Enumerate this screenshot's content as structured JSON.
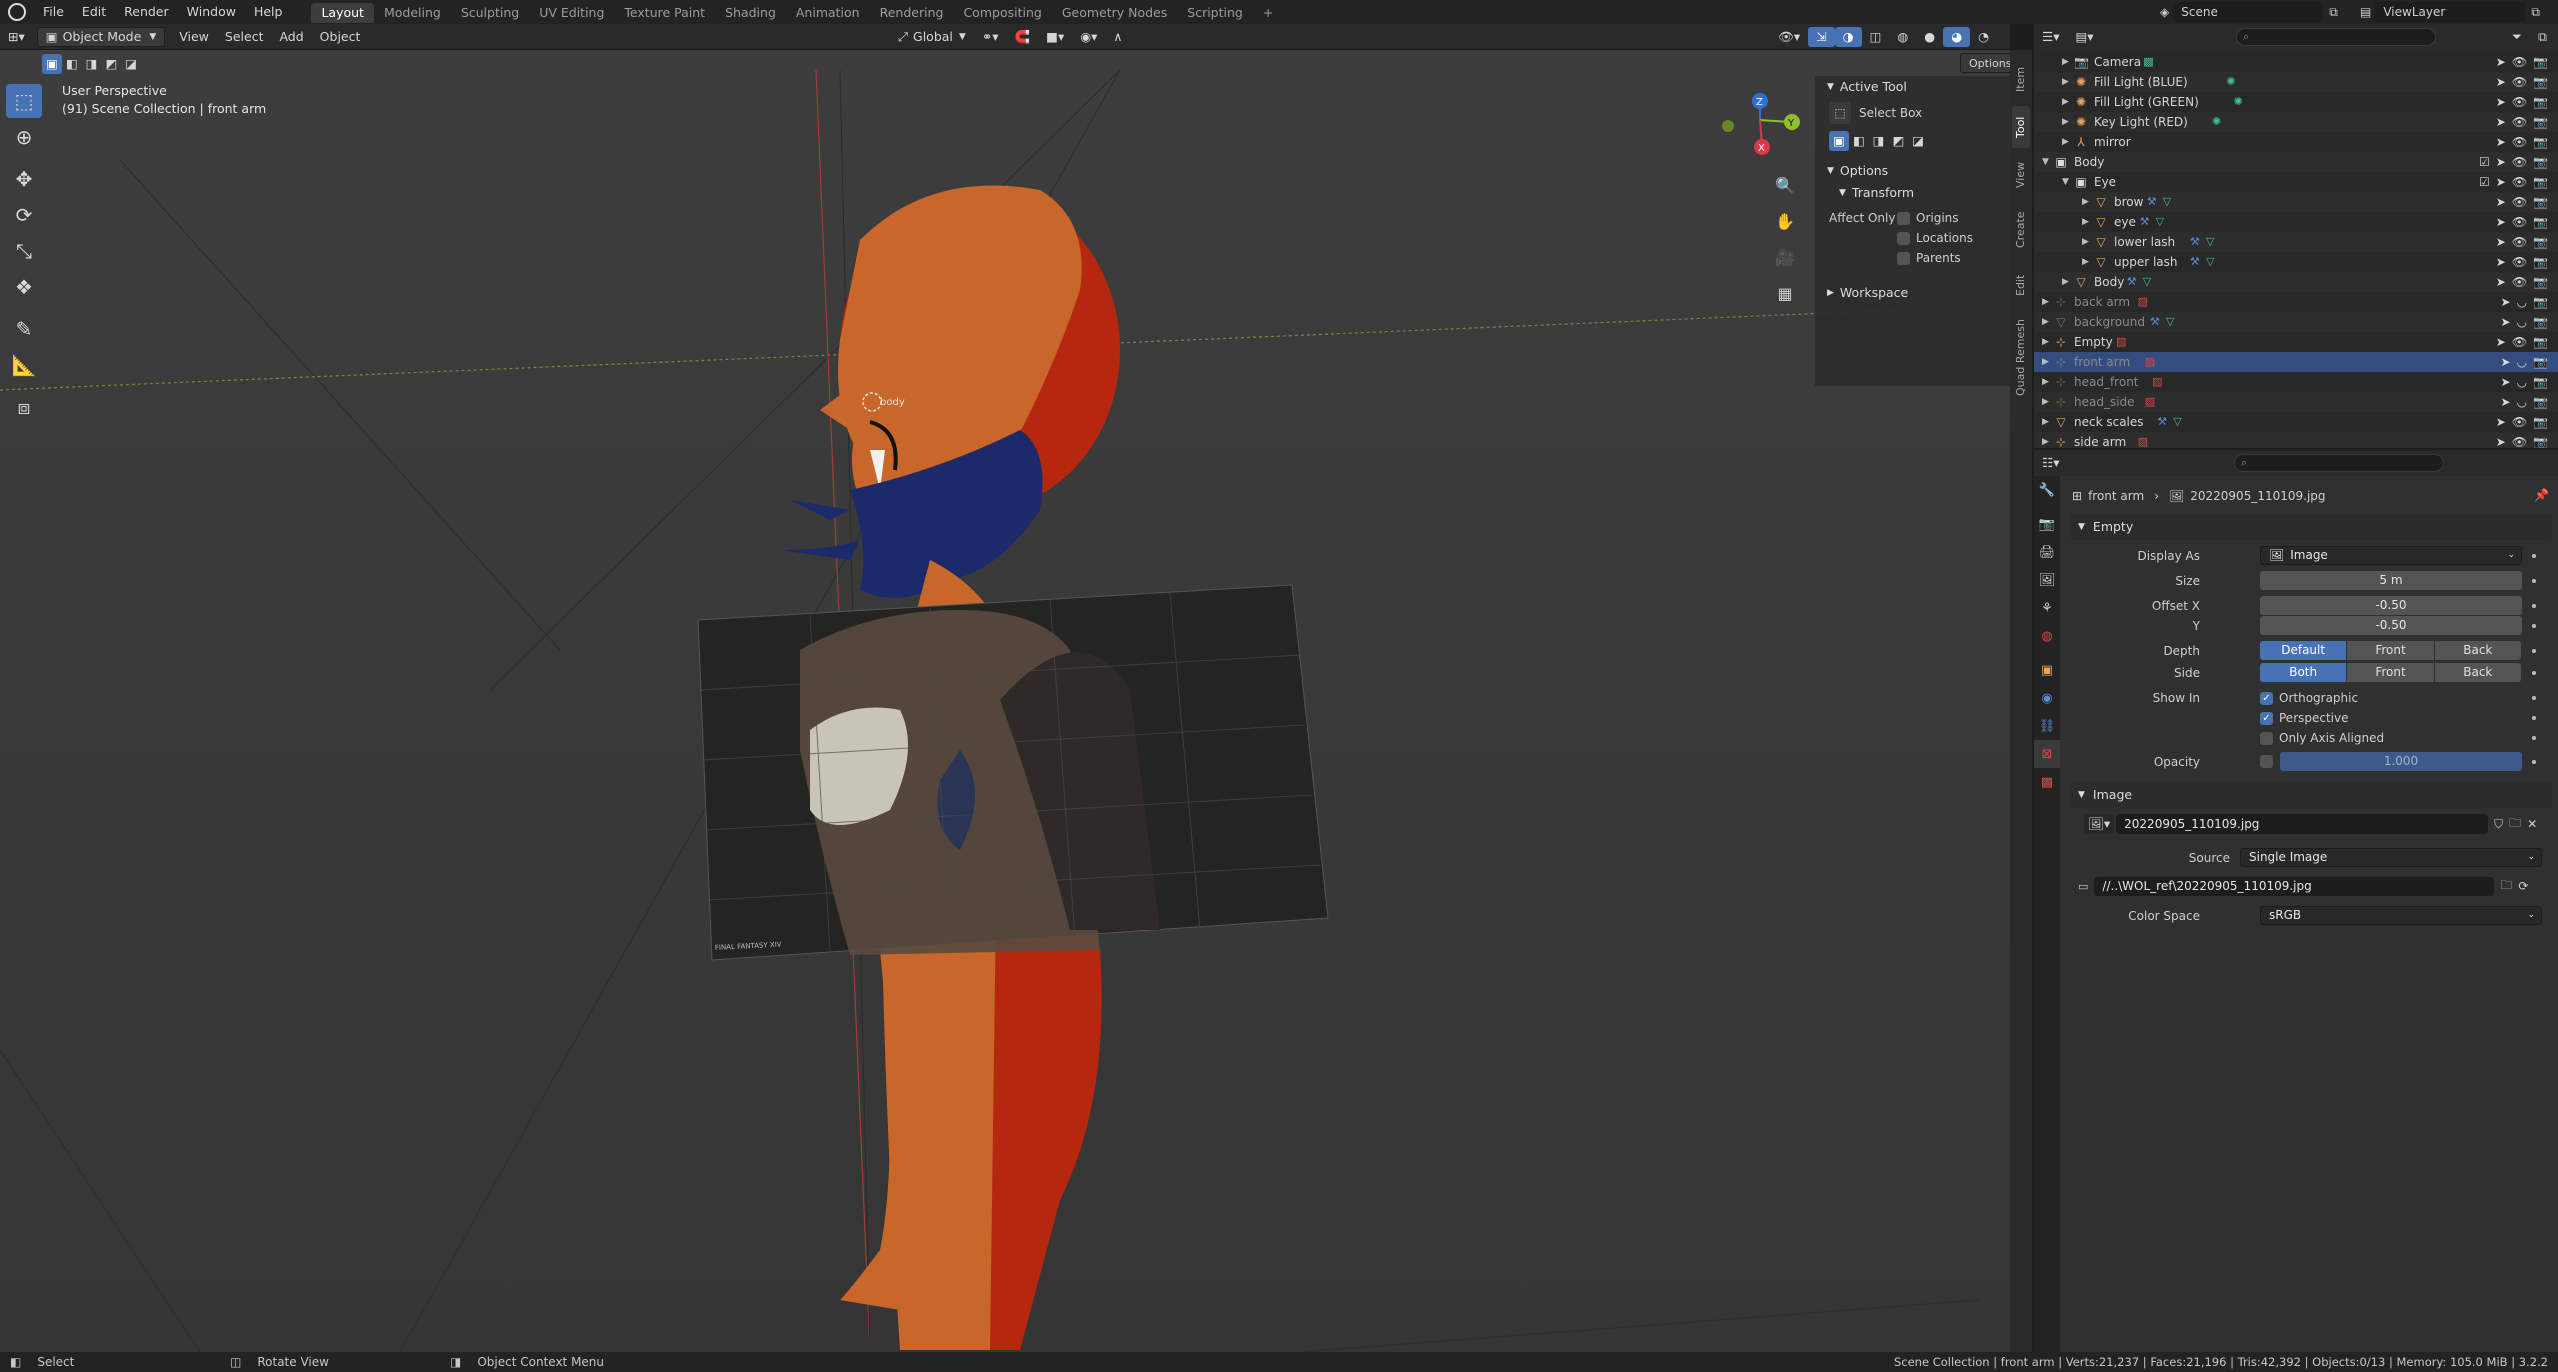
{
  "app": {
    "menus": [
      "File",
      "Edit",
      "Render",
      "Window",
      "Help"
    ],
    "workspaces": [
      "Layout",
      "Modeling",
      "Sculpting",
      "UV Editing",
      "Texture Paint",
      "Shading",
      "Animation",
      "Rendering",
      "Compositing",
      "Geometry Nodes",
      "Scripting"
    ],
    "active_workspace": "Layout",
    "add_tab": "+",
    "scene_label": "Scene",
    "viewlayer_label": "ViewLayer"
  },
  "viewport_header": {
    "mode": "Object Mode",
    "menus": [
      "View",
      "Select",
      "Add",
      "Object"
    ],
    "transform_orientation": "Global",
    "options_label": "Options"
  },
  "viewport": {
    "perspective": "User Perspective",
    "collection_info": "(91) Scene Collection | front arm",
    "object_label": "body",
    "image_caption": "FINAL FANTASY XIV",
    "gizmo_axes": {
      "x": "X",
      "y": "Y",
      "z": "Z"
    }
  },
  "toolbar": {
    "tools": [
      "select-box",
      "cursor",
      "move",
      "rotate",
      "scale",
      "transform",
      "annotate",
      "measure",
      "add-cube"
    ],
    "active": "select-box"
  },
  "n_panel": {
    "active_tool_header": "Active Tool",
    "tool_name": "Select Box",
    "options_header": "Options",
    "transform_header": "Transform",
    "affect_only_label": "Affect Only",
    "affect_only": [
      {
        "label": "Origins",
        "checked": false
      },
      {
        "label": "Locations",
        "checked": false
      },
      {
        "label": "Parents",
        "checked": false
      }
    ],
    "workspace_header": "Workspace"
  },
  "n_tabs": [
    "Item",
    "Tool",
    "View",
    "Create",
    "Edit",
    "Quad Remesh"
  ],
  "n_tab_active": "Tool",
  "outliner": {
    "rows": [
      {
        "label": "Camera",
        "depth": 1,
        "icon": "camera-icon",
        "color": "#e8a35c",
        "dim": false,
        "selected": false
      },
      {
        "label": "Fill Light (BLUE)",
        "depth": 1,
        "icon": "light-icon",
        "color": "#e8a35c",
        "dim": false,
        "selected": false
      },
      {
        "label": "Fill Light (GREEN)",
        "depth": 1,
        "icon": "light-icon",
        "color": "#e8a35c",
        "dim": false,
        "selected": false
      },
      {
        "label": "Key Light (RED)",
        "depth": 1,
        "icon": "light-icon",
        "color": "#e8a35c",
        "dim": false,
        "selected": false
      },
      {
        "label": "mirror",
        "depth": 1,
        "icon": "armature-icon",
        "color": "#e8a35c",
        "dim": false,
        "selected": false
      },
      {
        "label": "Body",
        "depth": 0,
        "icon": "collection-icon",
        "color": "#e0e0e0",
        "dim": false,
        "selected": false
      },
      {
        "label": "Eye",
        "depth": 1,
        "icon": "collection-icon",
        "color": "#e0e0e0",
        "dim": false,
        "selected": false
      },
      {
        "label": "brow",
        "depth": 2,
        "icon": "mesh-icon",
        "color": "#e8a35c",
        "dim": false,
        "selected": false
      },
      {
        "label": "eye",
        "depth": 2,
        "icon": "mesh-icon",
        "color": "#e8a35c",
        "dim": false,
        "selected": false
      },
      {
        "label": "lower lash",
        "depth": 2,
        "icon": "mesh-icon",
        "color": "#e8a35c",
        "dim": false,
        "selected": false
      },
      {
        "label": "upper lash",
        "depth": 2,
        "icon": "mesh-icon",
        "color": "#e8a35c",
        "dim": false,
        "selected": false
      },
      {
        "label": "Body",
        "depth": 1,
        "icon": "mesh-icon",
        "color": "#e8a35c",
        "dim": false,
        "selected": false
      },
      {
        "label": "back arm",
        "depth": 0,
        "icon": "empty-icon",
        "color": "#e8a35c",
        "dim": true,
        "selected": false
      },
      {
        "label": "background",
        "depth": 0,
        "icon": "mesh-icon",
        "color": "#e8a35c",
        "dim": true,
        "selected": false
      },
      {
        "label": "Empty",
        "depth": 0,
        "icon": "empty-icon",
        "color": "#e8a35c",
        "dim": false,
        "selected": false
      },
      {
        "label": "front arm",
        "depth": 0,
        "icon": "empty-icon",
        "color": "#e8a35c",
        "dim": true,
        "selected": true
      },
      {
        "label": "head_front",
        "depth": 0,
        "icon": "empty-icon",
        "color": "#e8a35c",
        "dim": true,
        "selected": false
      },
      {
        "label": "head_side",
        "depth": 0,
        "icon": "empty-icon",
        "color": "#e8a35c",
        "dim": true,
        "selected": false
      },
      {
        "label": "neck scales",
        "depth": 0,
        "icon": "mesh-icon",
        "color": "#e8a35c",
        "dim": false,
        "selected": false
      },
      {
        "label": "side arm",
        "depth": 0,
        "icon": "empty-icon",
        "color": "#e8a35c",
        "dim": false,
        "selected": false
      }
    ]
  },
  "properties": {
    "breadcrumb_object": "front arm",
    "breadcrumb_data": "20220905_110109.jpg",
    "empty_section": "Empty",
    "display_as_label": "Display As",
    "display_as_value": "Image",
    "size_label": "Size",
    "size_value": "5 m",
    "offset_x_label": "Offset X",
    "offset_x_value": "-0.50",
    "offset_y_label": "Y",
    "offset_y_value": "-0.50",
    "depth_label": "Depth",
    "depth_options": [
      "Default",
      "Front",
      "Back"
    ],
    "depth_selected": "Default",
    "side_label": "Side",
    "side_options": [
      "Both",
      "Front",
      "Back"
    ],
    "side_selected": "Both",
    "show_in_label": "Show In",
    "show_in": [
      {
        "label": "Orthographic",
        "checked": true
      },
      {
        "label": "Perspective",
        "checked": true
      },
      {
        "label": "Only Axis Aligned",
        "checked": false
      }
    ],
    "opacity_label": "Opacity",
    "opacity_value": "1.000",
    "image_section": "Image",
    "image_name": "20220905_110109.jpg",
    "source_label": "Source",
    "source_value": "Single Image",
    "filepath": "//..\\WOL_ref\\20220905_110109.jpg",
    "color_space_label": "Color Space",
    "color_space_value": "sRGB"
  },
  "statusbar": {
    "left": [
      {
        "icon": "mouse-left-icon",
        "label": "Select"
      },
      {
        "icon": "mouse-middle-icon",
        "label": "Rotate View"
      },
      {
        "icon": "mouse-right-icon",
        "label": "Object Context Menu"
      }
    ],
    "stats": "Scene Collection | front arm | Verts:21,237 | Faces:21,196 | Tris:42,392 | Objects:0/13 | Memory: 105.0 MiB | 3.2.2"
  },
  "colors": {
    "accent": "#4772b3",
    "selected_row": "#334d80",
    "object_orange": "#e8a35c",
    "character_skin": "#c9672a",
    "character_red": "#b5280f",
    "character_navy": "#1c2a6b"
  }
}
